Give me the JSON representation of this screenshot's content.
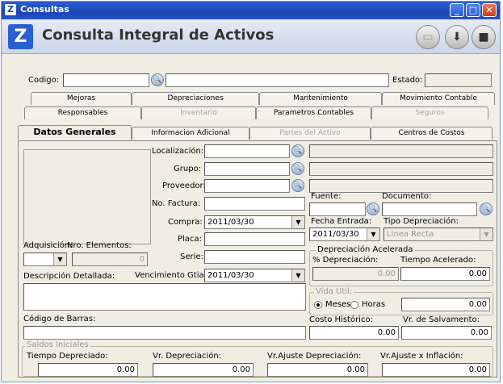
{
  "window": {
    "title": "Consultas",
    "heading": "Consulta Integral de Activos"
  },
  "top": {
    "codigo_label": "Codigo:",
    "codigo_value": "",
    "descripcion_value": "",
    "estado_label": "Estado:",
    "estado_value": ""
  },
  "tabs": {
    "row1": [
      "Mejoras",
      "Depreciaciones",
      "Mantenimiento",
      "Movimiento Contable"
    ],
    "row2": [
      "Responsables",
      "Inventario",
      "Parametros Contables",
      "Seguros"
    ],
    "row3": [
      "Datos Generales",
      "Informacion Adicional",
      "Partes del Activo",
      "Centros de Costos"
    ]
  },
  "form": {
    "localizacion_label": "Localización:",
    "grupo_label": "Grupo:",
    "proveedor_label": "Proveedor:",
    "factura_label": "No. Factura:",
    "compra_label": "Compra:",
    "compra_value": "2011/03/30",
    "placa_label": "Placa:",
    "serie_label": "Serie:",
    "vencimiento_label": "Vencimiento Gtia:",
    "vencimiento_value": "2011/03/30",
    "adquisicion_label": "Adquisición:",
    "nro_elementos_label": "Nro. Elementos:",
    "nro_elementos_value": "0",
    "descripcion_label": "Descripción Detallada:",
    "codigo_barras_label": "Código de Barras:",
    "fuente_label": "Fuente:",
    "documento_label": "Documento:",
    "fecha_entrada_label": "Fecha Entrada:",
    "fecha_entrada_value": "2011/03/30",
    "tipo_depreciacion_label": "Tipo Depreciación:",
    "tipo_depreciacion_value": "Linea Recta",
    "dep_acelerada_title": "Depreciación Acelerada",
    "pct_depreciacion_label": "% Depreciación:",
    "pct_depreciacion_value": "0.00",
    "tiempo_acelerado_label": "Tiempo Acelerado:",
    "tiempo_acelerado_value": "0.00",
    "vida_util_title": "Vida Util:",
    "meses_label": "Meses",
    "horas_label": "Horas",
    "vida_util_value": "0.00",
    "costo_historico_label": "Costo Histórico:",
    "costo_historico_value": "0.00",
    "salvamento_label": "Vr. de Salvamento:",
    "salvamento_value": "0.00"
  },
  "saldos": {
    "title": "Saldos Iniciales",
    "tiempo_label": "Tiempo Depreciado:",
    "tiempo_value": "0.00",
    "vr_dep_label": "Vr. Depreciación:",
    "vr_dep_value": "0.00",
    "vr_ajuste_dep_label": "Vr.Ajuste Depreciación:",
    "vr_ajuste_dep_value": "0.00",
    "vr_ajuste_inf_label": "Vr.Ajuste x Inflación:",
    "vr_ajuste_inf_value": "0.00"
  }
}
